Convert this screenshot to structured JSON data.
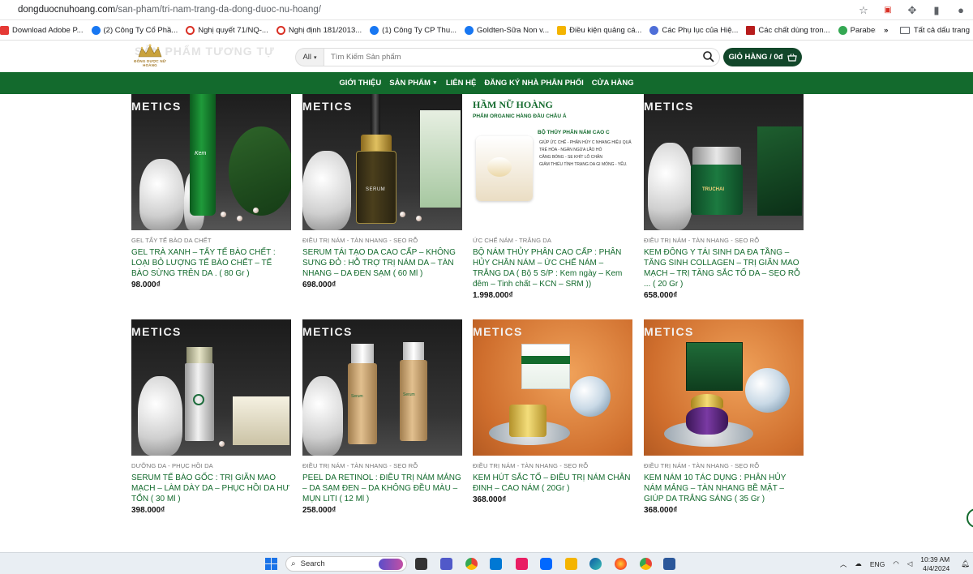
{
  "browser": {
    "url_host": "dongduocnuhoang.com",
    "url_path": "/san-pham/tri-nam-trang-da-dong-duoc-nu-hoang/",
    "bookmarks": [
      {
        "label": "Download Adobe P...",
        "icon": "pdf-icon"
      },
      {
        "label": "(2) Công Ty Cổ Phầ...",
        "icon": "facebook-icon"
      },
      {
        "label": "Nghị quyết 71/NQ-...",
        "icon": "red-circle-icon"
      },
      {
        "label": "Nghị định 181/2013...",
        "icon": "red-circle-icon"
      },
      {
        "label": "(1) Công Ty CP Thu...",
        "icon": "facebook-icon"
      },
      {
        "label": "Goldten-Sữa Non v...",
        "icon": "facebook-icon"
      },
      {
        "label": "Điều kiện quảng cá...",
        "icon": "arrow-icon"
      },
      {
        "label": "Các Phụ lục của Hiệ...",
        "icon": "doc-icon"
      },
      {
        "label": "Các chất dùng tron...",
        "icon": "flag-icon"
      },
      {
        "label": "Paraben là gì? Tác h...",
        "icon": "green-icon"
      }
    ],
    "bookmarks_more": "»",
    "all_bookmarks": "Tất cả dấu trang"
  },
  "header": {
    "logo_text": "ĐÔNG DƯỢC NỮ HOÀNG",
    "ghost_title": "SẢN PHẨM TƯƠNG TỰ",
    "search_category": "All",
    "search_placeholder": "Tìm Kiếm Sản phẩm",
    "cart_label": "GIỎ HÀNG / 0đ"
  },
  "nav": {
    "items": [
      "GIỚI THIỆU",
      "SẢN PHẨM",
      "LIÊN HỆ",
      "ĐĂNG KÝ NHÀ PHÂN PHỐI",
      "CỬA HÀNG"
    ]
  },
  "banner_text": {
    "metics": "METICS",
    "hoang": "HẦM NỮ HOÀNG",
    "subtitle": "PHẨM ORGANIC HÀNG ĐẦU CHÂU Á",
    "kit_title": "BỘ THỦY PHÂN NÁM CAO C",
    "bullets": [
      "GIÚP ỨC CHẾ - PHÂN HỦY C NHANG HIỆU QUẢ",
      "TRẺ HÓA - NGĂN NGỪA LÃO HÓ",
      "CĂNG BÓNG - SE KHÍT LỖ CHÂN",
      "GIẢM THIỂU TÌNH TRẠNG DA GI MỎNG - YẾU."
    ],
    "brand": "TRUCHAI"
  },
  "products": [
    {
      "category": "GEL TẨY TẾ BÀO DA CHẾT",
      "name": "GEL TRÀ XANH – TẨY TẾ BÀO CHẾT : LOẠI BỎ LƯỢNG TẾ BÀO CHẾT – TẾ BÀO SỪNG TRÊN DA . ( 80 Gr )",
      "price": "98.000₫"
    },
    {
      "category": "ĐIỀU TRỊ NÁM - TÀN NHANG - SẸO RỖ",
      "name": "SERUM TÁI TẠO DA CAO CẤP – KHÔNG SƯNG ĐỎ : HỖ TRỢ TRỊ NÁM DA – TÀN NHANG – DA ĐEN SẠM ( 60 Ml )",
      "price": "698.000₫"
    },
    {
      "category": "ỨC CHẾ NÁM - TRẮNG DA",
      "name": "BỘ NÁM THỦY PHÂN CAO CẤP : PHÂN HỦY CHÂN NÁM – ỨC CHẾ NÁM – TRẮNG DA ( Bộ 5 S/P : Kem ngày – Kem đêm – Tinh chất – KCN – SRM ))",
      "price": "1.998.000₫"
    },
    {
      "category": "ĐIỀU TRỊ NÁM - TÀN NHANG - SẸO RỖ",
      "name": "KEM ĐÔNG Y TÁI SINH DA ĐA TẦNG – TĂNG SINH COLLAGEN – TRỊ GIÃN MAO MẠCH – TRỊ TĂNG SẮC TỐ DA – SẸO RỖ ... ( 20 Gr )",
      "price": "658.000₫"
    },
    {
      "category": "DƯỠNG DA - PHỤC HỒI DA",
      "name": "SERUM TẾ BÀO GỐC : TRỊ GIÃN MAO MẠCH – LÀM DÀY DA – PHỤC HỒI DA HƯ TỔN ( 30 Ml )",
      "price": "398.000₫"
    },
    {
      "category": "ĐIỀU TRỊ NÁM - TÀN NHANG - SẸO RỖ",
      "name": "PEEL DA RETINOL : ĐIỀU TRỊ NÁM MẢNG – DA SẠM ĐEN – DA KHÔNG ĐỀU MÀU – MỤN LITI ( 12 Ml )",
      "price": "258.000₫"
    },
    {
      "category": "ĐIỀU TRỊ NÁM - TÀN NHANG - SẸO RỖ",
      "name": "KEM HÚT SẮC TỐ – ĐIỀU TRỊ NÁM CHÂN ĐINH – CAO NÁM ( 20Gr )",
      "price": "368.000₫"
    },
    {
      "category": "ĐIỀU TRỊ NÁM - TÀN NHANG - SẸO RỖ",
      "name": "KEM NÁM 10 TÁC DỤNG : PHÂN HỦY NÁM MẢNG – TÀN NHANG BỀ MẶT – GIÚP DA TRẮNG SÁNG ( 35 Gr )",
      "price": "368.000₫"
    }
  ],
  "taskbar": {
    "search_label": "Search",
    "lang": "ENG",
    "time": "10:39 AM",
    "date": "4/4/2024"
  },
  "colors": {
    "brand_green": "#136a2d",
    "cart_green": "#12472a",
    "product_title": "#136a2d"
  }
}
